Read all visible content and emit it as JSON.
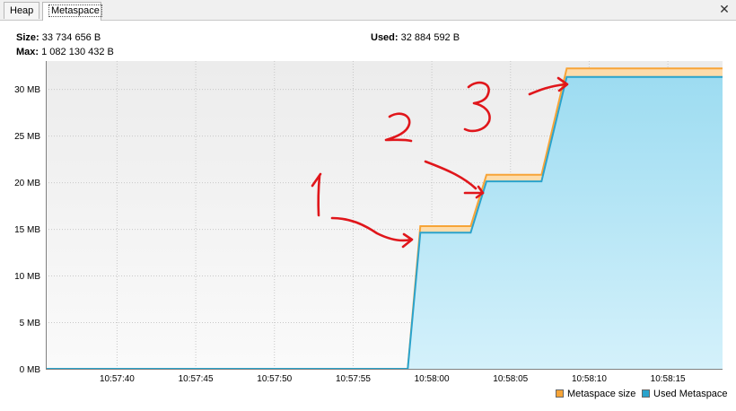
{
  "tabs": [
    {
      "label": "Heap",
      "active": false
    },
    {
      "label": "Metaspace",
      "active": true
    }
  ],
  "close_icon": "close-icon",
  "stats": {
    "size_label": "Size:",
    "size_value": "33 734 656 B",
    "max_label": "Max:",
    "max_value": "1 082 130 432 B",
    "used_label": "Used:",
    "used_value": "32 884 592 B"
  },
  "chart_data": {
    "type": "area",
    "y_ticks": [
      "0 MB",
      "5 MB",
      "10 MB",
      "15 MB",
      "20 MB",
      "25 MB",
      "30 MB"
    ],
    "ylim": [
      0,
      33
    ],
    "x_ticks": [
      "10:57:40",
      "10:57:45",
      "10:57:50",
      "10:57:55",
      "10:58:00",
      "10:58:05",
      "10:58:10",
      "10:58:15"
    ],
    "x_tick_seconds": [
      40,
      45,
      50,
      55,
      60,
      65,
      70,
      75
    ],
    "xlim_seconds": [
      35.5,
      78.5
    ],
    "grid": true,
    "legend_position": "bottom-right",
    "series": [
      {
        "name": "Metaspace size",
        "color": "#f7a437",
        "fill": "#fddcab",
        "x": [
          35.5,
          58.5,
          59.3,
          62.5,
          63.5,
          67.0,
          68.6,
          78.5
        ],
        "y": [
          0,
          0,
          15.3,
          15.3,
          20.8,
          20.8,
          32.2,
          32.2
        ]
      },
      {
        "name": "Used Metaspace",
        "color": "#2aa3cc",
        "fill": "#a6e2f5",
        "x": [
          35.5,
          58.5,
          59.3,
          62.5,
          63.5,
          67.0,
          68.6,
          78.5
        ],
        "y": [
          0,
          0,
          14.6,
          14.6,
          20.1,
          20.1,
          31.3,
          31.3
        ]
      }
    ],
    "annotations": [
      "1",
      "2",
      "3"
    ]
  },
  "legend": [
    {
      "label": "Metaspace size",
      "color": "#f7a437"
    },
    {
      "label": "Used Metaspace",
      "color": "#2aa3cc"
    }
  ]
}
